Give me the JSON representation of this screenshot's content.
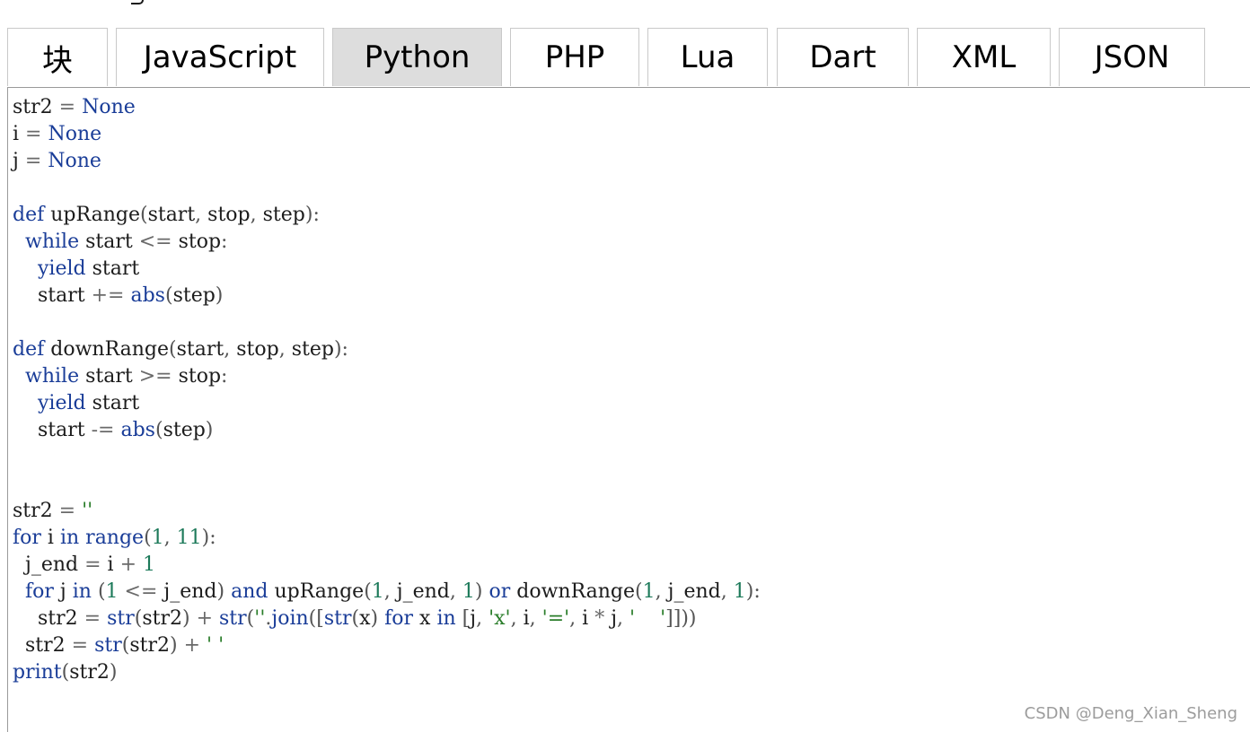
{
  "tabs": [
    {
      "label": "块",
      "active": false
    },
    {
      "label": "JavaScript",
      "active": false
    },
    {
      "label": "Python",
      "active": true
    },
    {
      "label": "PHP",
      "active": false
    },
    {
      "label": "Lua",
      "active": false
    },
    {
      "label": "Dart",
      "active": false
    },
    {
      "label": "XML",
      "active": false
    },
    {
      "label": "JSON",
      "active": false
    }
  ],
  "colors": {
    "active_tab_bg": "#dddddd",
    "keyword": "#1a3d98",
    "number": "#1d7a5a",
    "string": "#2a7d2a"
  },
  "code": {
    "language": "Python",
    "lines": [
      "str2 = None",
      "i = None",
      "j = None",
      "",
      "def upRange(start, stop, step):",
      "  while start <= stop:",
      "    yield start",
      "    start += abs(step)",
      "",
      "def downRange(start, stop, step):",
      "  while start >= stop:",
      "    yield start",
      "    start -= abs(step)",
      "",
      "",
      "str2 = ''",
      "for i in range(1, 11):",
      "  j_end = i + 1",
      "  for j in (1 <= j_end) and upRange(1, j_end, 1) or downRange(1, j_end, 1):",
      "    str2 = str(str2) + str(''.join([str(x) for x in [j, 'x', i, '=', i * j, '    ']]))",
      "  str2 = str(str2) + ' '",
      "print(str2)"
    ]
  },
  "watermark": "CSDN @Deng_Xian_Sheng"
}
